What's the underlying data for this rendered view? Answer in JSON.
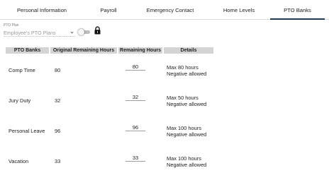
{
  "tabs": [
    {
      "label": "Personal Information",
      "active": false
    },
    {
      "label": "Payroll",
      "active": false
    },
    {
      "label": "Emergency Contact",
      "active": false
    },
    {
      "label": "Home Levels",
      "active": false
    },
    {
      "label": "PTO Banks",
      "active": true
    }
  ],
  "pto_plan": {
    "label": "PTO Plan",
    "placeholder": "Employee's PTO Plans",
    "toggle_on": false
  },
  "table": {
    "headers": [
      "PTO Banks",
      "Original Remaining Hours",
      "Remaining Hours",
      "Details"
    ],
    "rows": [
      {
        "bank": "Comp Time",
        "original": "80",
        "remaining": "80",
        "details_line1": "Max 80 hours",
        "details_line2": "Negative allowed"
      },
      {
        "bank": "Jury Duty",
        "original": "32",
        "remaining": "32",
        "details_line1": "Max 50 hours",
        "details_line2": "Negative allowed"
      },
      {
        "bank": "Personal Leave",
        "original": "96",
        "remaining": "96",
        "details_line1": "Max 100 hours",
        "details_line2": "Negative allowed"
      },
      {
        "bank": "Vacation",
        "original": "33",
        "remaining": "33",
        "details_line1": "Max 100 hours",
        "details_line2": "Negative allowed"
      }
    ]
  },
  "colors": {
    "active_tab_underline": "#1f3a56",
    "header_bg": "#d4d4d4"
  }
}
